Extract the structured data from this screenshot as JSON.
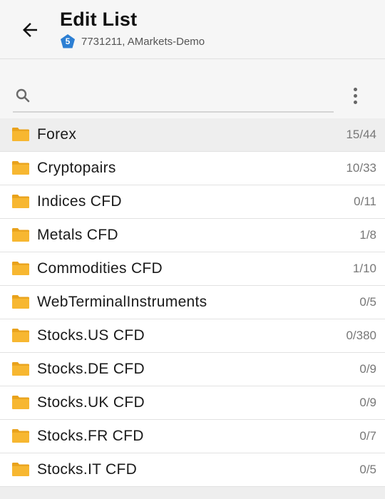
{
  "header": {
    "title": "Edit List",
    "account_badge": "5",
    "account": "7731211, AMarkets-Demo",
    "back_icon": "arrow-left-icon"
  },
  "search": {
    "placeholder": "",
    "value": "",
    "menu_icon": "more-vertical-icon"
  },
  "colors": {
    "folder": "#f7b731",
    "badge": "#2d7fd3",
    "selected_row": "#eeeeee"
  },
  "groups": [
    {
      "name": "Forex",
      "count": "15/44",
      "selected": true
    },
    {
      "name": "Cryptopairs",
      "count": "10/33"
    },
    {
      "name": "Indices CFD",
      "count": "0/11"
    },
    {
      "name": "Metals CFD",
      "count": "1/8"
    },
    {
      "name": "Commodities CFD",
      "count": "1/10"
    },
    {
      "name": "WebTerminalInstruments",
      "count": "0/5"
    },
    {
      "name": "Stocks.US CFD",
      "count": "0/380"
    },
    {
      "name": "Stocks.DE CFD",
      "count": "0/9"
    },
    {
      "name": "Stocks.UK CFD",
      "count": "0/9"
    },
    {
      "name": "Stocks.FR CFD",
      "count": "0/7"
    },
    {
      "name": "Stocks.IT CFD",
      "count": "0/5"
    }
  ]
}
